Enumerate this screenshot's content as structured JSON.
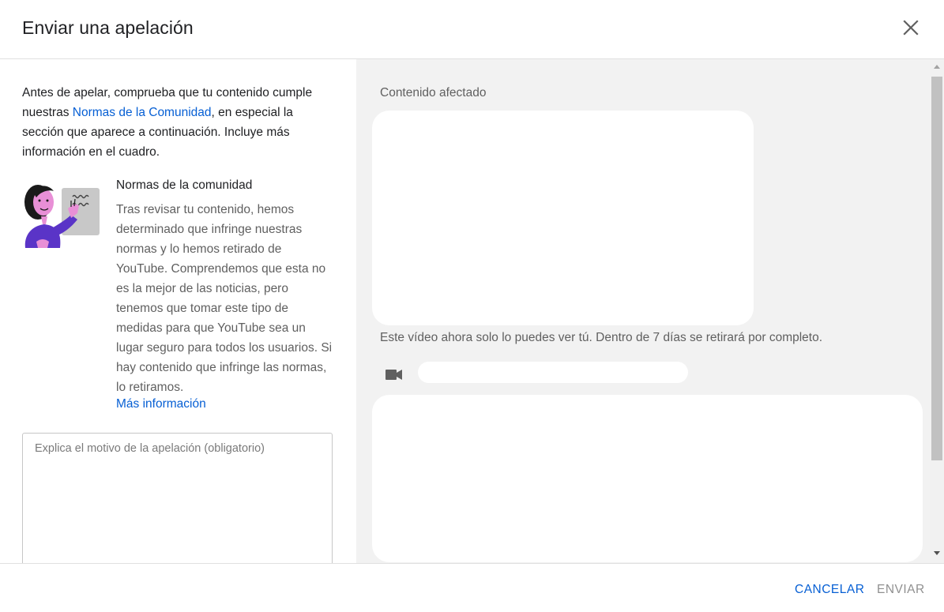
{
  "dialog": {
    "title": "Enviar una apelación",
    "close_icon": "close-icon"
  },
  "left": {
    "intro_before_link": "Antes de apelar, comprueba que tu contenido cumple nuestras ",
    "intro_link": "Normas de la Comunidad",
    "intro_after_link": ", en especial la sección que aparece a continuación. Incluye más información en el cuadro.",
    "guide_title": "Normas de la comunidad",
    "guide_text": "Tras revisar tu contenido, hemos determinado que infringe nuestras normas y lo hemos retirado de YouTube. Comprendemos que esta no es la mejor de las noticias, pero tenemos que tomar este tipo de medidas para que YouTube sea un lugar seguro para todos los usuarios. Si hay contenido que infringe las normas, lo retiramos.",
    "more_info_link": "Más información",
    "reason_placeholder": "Explica el motivo de la apelación (obligatorio)",
    "reason_value": ""
  },
  "right": {
    "section_label": "Contenido afectado",
    "status_text": "Este vídeo ahora solo lo puedes ver tú. Dentro de 7 días se retirará por completo.",
    "video_icon": "video-camera-icon"
  },
  "footer": {
    "cancel_label": "CANCELAR",
    "send_label": "ENVIAR"
  },
  "colors": {
    "link": "#065fd4",
    "muted_text": "#606060",
    "panel_bg": "#f2f2f2",
    "disabled_button": "#909090"
  }
}
